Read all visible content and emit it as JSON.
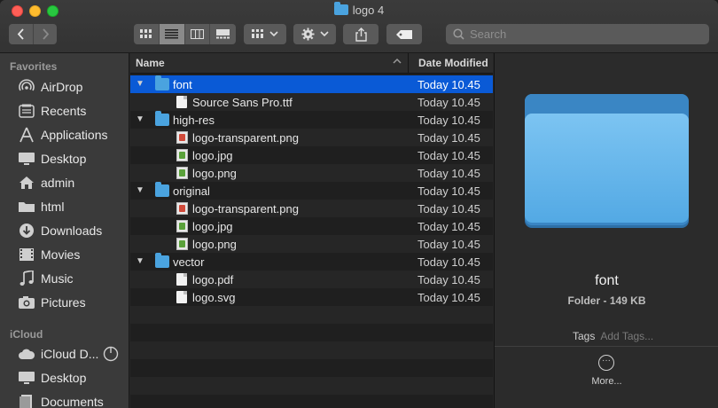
{
  "window": {
    "title": "logo 4",
    "search_placeholder": "Search"
  },
  "sidebar": {
    "sections": [
      {
        "title": "Favorites"
      },
      {
        "title": "iCloud"
      }
    ],
    "favorites": [
      {
        "label": "AirDrop",
        "icon": "airdrop-icon"
      },
      {
        "label": "Recents",
        "icon": "recents-icon"
      },
      {
        "label": "Applications",
        "icon": "applications-icon"
      },
      {
        "label": "Desktop",
        "icon": "desktop-icon"
      },
      {
        "label": "admin",
        "icon": "home-icon"
      },
      {
        "label": "html",
        "icon": "folder-icon"
      },
      {
        "label": "Downloads",
        "icon": "downloads-icon"
      },
      {
        "label": "Movies",
        "icon": "movies-icon"
      },
      {
        "label": "Music",
        "icon": "music-icon"
      },
      {
        "label": "Pictures",
        "icon": "pictures-icon"
      }
    ],
    "icloud": [
      {
        "label": "iCloud D...",
        "icon": "cloud-icon"
      },
      {
        "label": "Desktop",
        "icon": "desktop-icon"
      },
      {
        "label": "Documents",
        "icon": "documents-icon"
      }
    ]
  },
  "list": {
    "col_name": "Name",
    "col_date": "Date Modified",
    "rows": [
      {
        "name": "font",
        "date": "Today 10.45",
        "type": "folder",
        "expanded": true
      },
      {
        "name": "Source Sans Pro.ttf",
        "date": "Today 10.45",
        "type": "doc"
      },
      {
        "name": "high-res",
        "date": "Today 10.45",
        "type": "folder",
        "expanded": true
      },
      {
        "name": "logo-transparent.png",
        "date": "Today 10.45",
        "type": "image"
      },
      {
        "name": "logo.jpg",
        "date": "Today 10.45",
        "type": "image"
      },
      {
        "name": "logo.png",
        "date": "Today 10.45",
        "type": "image"
      },
      {
        "name": "original",
        "date": "Today 10.45",
        "type": "folder",
        "expanded": true
      },
      {
        "name": "logo-transparent.png",
        "date": "Today 10.45",
        "type": "image"
      },
      {
        "name": "logo.jpg",
        "date": "Today 10.45",
        "type": "image"
      },
      {
        "name": "logo.png",
        "date": "Today 10.45",
        "type": "image"
      },
      {
        "name": "vector",
        "date": "Today 10.45",
        "type": "folder",
        "expanded": true
      },
      {
        "name": "logo.pdf",
        "date": "Today 10.45",
        "type": "doc"
      },
      {
        "name": "logo.svg",
        "date": "Today 10.45",
        "type": "doc"
      }
    ]
  },
  "preview": {
    "name": "font",
    "info": "Folder - 149 KB",
    "tags_label": "Tags",
    "add_tags": "Add Tags...",
    "more": "More..."
  },
  "colors": {
    "selection": "#0a5ad6",
    "folder": "#4aa3df"
  }
}
